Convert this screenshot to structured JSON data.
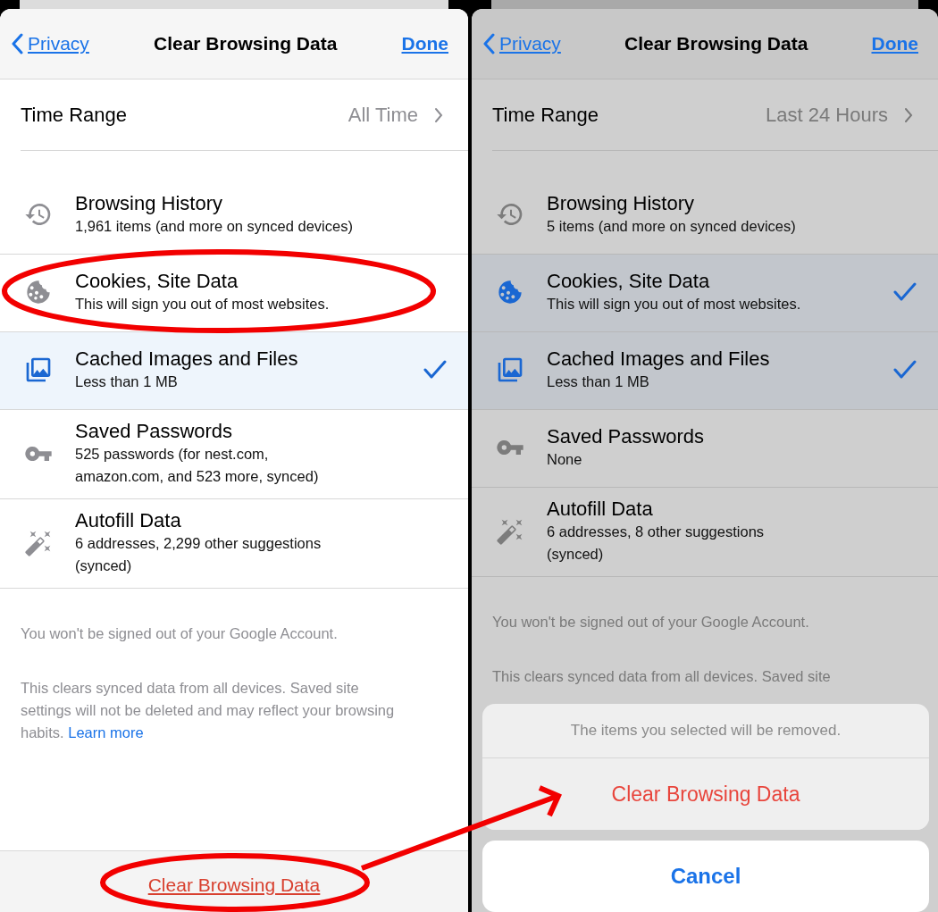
{
  "screens": [
    {
      "dimmed": false,
      "nav": {
        "back": "Privacy",
        "title": "Clear Browsing Data",
        "done": "Done"
      },
      "time_range": {
        "label": "Time Range",
        "value": "All Time"
      },
      "items": [
        {
          "kind": "history",
          "title": "Browsing History",
          "detail": "1,961 items (and more on synced devices)",
          "selected": false
        },
        {
          "kind": "cookies",
          "title": "Cookies, Site Data",
          "detail": "This will sign you out of most websites.",
          "selected": false
        },
        {
          "kind": "cache",
          "title": "Cached Images and Files",
          "detail": "Less than 1 MB",
          "selected": true
        },
        {
          "kind": "passwords",
          "title": "Saved Passwords",
          "detail": "525 passwords (for nest.com,\namazon.com, and 523 more, synced)",
          "selected": false
        },
        {
          "kind": "autofill",
          "title": "Autofill Data",
          "detail": "6 addresses, 2,299 other suggestions\n(synced)",
          "selected": false
        }
      ],
      "notes": [
        {
          "text": "You won't be signed out of your Google Account."
        },
        {
          "text": "This clears synced data from all devices. Saved site settings will not be deleted and may reflect your browsing habits.",
          "link": "Learn more"
        }
      ],
      "toolbar_button": "Clear Browsing Data"
    },
    {
      "dimmed": true,
      "nav": {
        "back": "Privacy",
        "title": "Clear Browsing Data",
        "done": "Done"
      },
      "time_range": {
        "label": "Time Range",
        "value": "Last 24 Hours"
      },
      "items": [
        {
          "kind": "history",
          "title": "Browsing History",
          "detail": "5 items (and more on synced devices)",
          "selected": false
        },
        {
          "kind": "cookies",
          "title": "Cookies, Site Data",
          "detail": "This will sign you out of most websites.",
          "selected": true
        },
        {
          "kind": "cache",
          "title": "Cached Images and Files",
          "detail": "Less than 1 MB",
          "selected": true
        },
        {
          "kind": "passwords",
          "title": "Saved Passwords",
          "detail": "None",
          "selected": false
        },
        {
          "kind": "autofill",
          "title": "Autofill Data",
          "detail": "6 addresses, 8 other suggestions\n(synced)",
          "selected": false
        }
      ],
      "notes": [
        {
          "text": "You won't be signed out of your Google Account."
        },
        {
          "text": "This clears synced data from all devices. Saved site"
        }
      ],
      "action_sheet": {
        "message": "The items you selected will be removed.",
        "action": "Clear Browsing Data",
        "cancel": "Cancel"
      }
    }
  ]
}
